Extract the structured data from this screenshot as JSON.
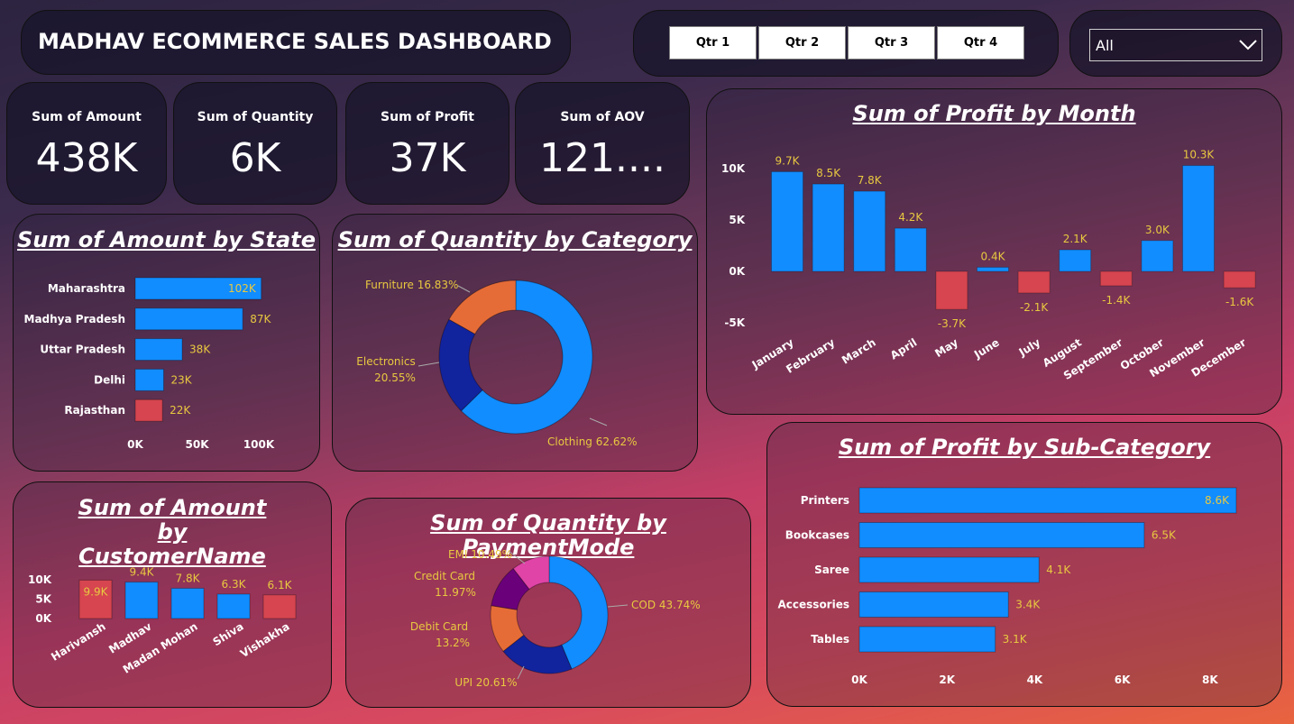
{
  "header": {
    "title": "MADHAV ECOMMERCE SALES DASHBOARD"
  },
  "quarter_filter": {
    "buttons": [
      "Qtr 1",
      "Qtr 2",
      "Qtr 3",
      "Qtr 4"
    ]
  },
  "dropdown": {
    "selected": "All"
  },
  "kpis": [
    {
      "label": "Sum of Amount",
      "value": "438K"
    },
    {
      "label": "Sum of Quantity",
      "value": "6K"
    },
    {
      "label": "Sum of Profit",
      "value": "37K"
    },
    {
      "label": "Sum of AOV",
      "value": "121...."
    }
  ],
  "colors": {
    "positive": "#118dff",
    "negative": "#d64550",
    "label": "#e8c840",
    "orange": "#e66c37",
    "navy": "#12239e",
    "purple": "#6b007b",
    "pink": "#e044a7"
  },
  "chart_data": [
    {
      "id": "profit-by-month",
      "type": "bar",
      "title": "Sum of Profit by Month",
      "categories": [
        "January",
        "February",
        "March",
        "April",
        "May",
        "June",
        "July",
        "August",
        "September",
        "October",
        "November",
        "December"
      ],
      "values": [
        9.7,
        8.5,
        7.8,
        4.2,
        -3.7,
        0.4,
        -2.1,
        2.1,
        -1.4,
        3.0,
        10.3,
        -1.6
      ],
      "value_labels": [
        "9.7K",
        "8.5K",
        "7.8K",
        "4.2K",
        "-3.7K",
        "0.4K",
        "-2.1K",
        "2.1K",
        "-1.4K",
        "3.0K",
        "10.3K",
        "-1.6K"
      ],
      "y_ticks": [
        10,
        5,
        0,
        -5
      ],
      "y_tick_labels": [
        "10K",
        "5K",
        "0K",
        "-5K"
      ],
      "ylim": [
        -5,
        10
      ]
    },
    {
      "id": "amount-by-state",
      "type": "bar",
      "orientation": "horizontal",
      "title": "Sum of Amount by State",
      "categories": [
        "Maharashtra",
        "Madhya Pradesh",
        "Uttar Pradesh",
        "Delhi",
        "Rajasthan"
      ],
      "values": [
        102,
        87,
        38,
        23,
        22
      ],
      "value_labels": [
        "102K",
        "87K",
        "38K",
        "23K",
        "22K"
      ],
      "x_ticks": [
        0,
        50,
        100
      ],
      "x_tick_labels": [
        "0K",
        "50K",
        "100K"
      ]
    },
    {
      "id": "quantity-by-category",
      "type": "pie",
      "title": "Sum of Quantity by Category",
      "categories": [
        "Clothing",
        "Electronics",
        "Furniture"
      ],
      "values": [
        62.62,
        20.55,
        16.83
      ],
      "slice_labels": [
        "Clothing 62.62%",
        "Electronics",
        "20.55%",
        "Furniture 16.83%"
      ]
    },
    {
      "id": "amount-by-customer",
      "type": "bar",
      "title": "Sum of Amount by CustomerName",
      "categories": [
        "Harivansh",
        "Madhav",
        "Madan Mohan",
        "Shiva",
        "Vishakha"
      ],
      "values": [
        9.9,
        9.4,
        7.8,
        6.3,
        6.1
      ],
      "value_labels": [
        "9.9K",
        "9.4K",
        "7.8K",
        "6.3K",
        "6.1K"
      ],
      "y_ticks": [
        10,
        5,
        0
      ],
      "y_tick_labels": [
        "10K",
        "5K",
        "0K"
      ]
    },
    {
      "id": "quantity-by-paymentmode",
      "type": "pie",
      "title": "Sum of Quantity by PaymentMode",
      "categories": [
        "COD",
        "UPI",
        "Debit Card",
        "Credit Card",
        "EMI"
      ],
      "values": [
        43.74,
        20.61,
        13.2,
        11.97,
        10.49
      ],
      "slice_labels": [
        "COD 43.74%",
        "UPI 20.61%",
        "Debit Card",
        "13.2%",
        "Credit Card",
        "11.97%",
        "EMI 10.49%"
      ]
    },
    {
      "id": "profit-by-subcategory",
      "type": "bar",
      "orientation": "horizontal",
      "title": "Sum of Profit by Sub-Category",
      "categories": [
        "Printers",
        "Bookcases",
        "Saree",
        "Accessories",
        "Tables"
      ],
      "values": [
        8.6,
        6.5,
        4.1,
        3.4,
        3.1
      ],
      "value_labels": [
        "8.6K",
        "6.5K",
        "4.1K",
        "3.4K",
        "3.1K"
      ],
      "x_ticks": [
        0,
        2,
        4,
        6,
        8
      ],
      "x_tick_labels": [
        "0K",
        "2K",
        "4K",
        "6K",
        "8K"
      ]
    }
  ]
}
